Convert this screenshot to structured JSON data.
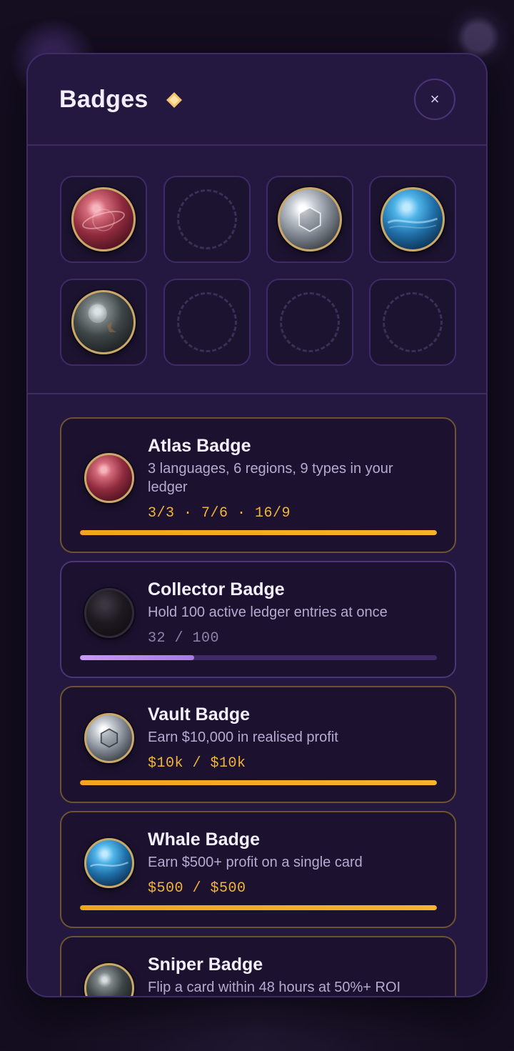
{
  "modal": {
    "title": "Badges",
    "close_label": "×"
  },
  "grid": [
    {
      "state": "unlocked",
      "orb": "red"
    },
    {
      "state": "empty"
    },
    {
      "state": "unlocked",
      "orb": "silver"
    },
    {
      "state": "unlocked",
      "orb": "blue"
    },
    {
      "state": "unlocked",
      "orb": "dark"
    },
    {
      "state": "empty"
    },
    {
      "state": "empty"
    },
    {
      "state": "empty"
    }
  ],
  "badges": [
    {
      "title": "Atlas Badge",
      "desc": "3 languages, 6 regions, 9 types in your ledger",
      "progress_text": "3/3 · 7/6 · 16/9",
      "progress": 1.0,
      "orb": "red",
      "unlocked": true
    },
    {
      "title": "Collector Badge",
      "desc": "Hold 100 active ledger entries at once",
      "progress_text": "32 / 100",
      "progress": 0.32,
      "orb": "black",
      "unlocked": false
    },
    {
      "title": "Vault Badge",
      "desc": "Earn $10,000 in realised profit",
      "progress_text": "$10k / $10k",
      "progress": 1.0,
      "orb": "silver",
      "unlocked": true
    },
    {
      "title": "Whale Badge",
      "desc": "Earn $500+ profit on a single card",
      "progress_text": "$500 / $500",
      "progress": 1.0,
      "orb": "blue",
      "unlocked": true
    },
    {
      "title": "Sniper Badge",
      "desc": "Flip a card within 48 hours at 50%+ ROI",
      "orb": "dark",
      "unlocked": true
    }
  ],
  "colors": {
    "accent_gold": "#f1b43a",
    "accent_purple": "#b98bef",
    "modal_bg": "#251840"
  }
}
